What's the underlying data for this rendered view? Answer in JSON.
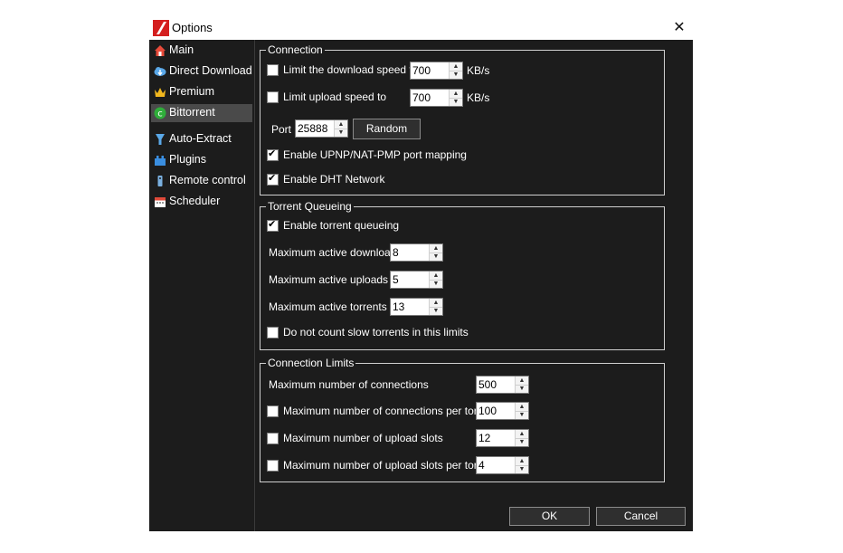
{
  "window": {
    "title": "Options",
    "close_glyph": "✕"
  },
  "sidebar": {
    "items": [
      {
        "label": "Main",
        "icon": "home-icon",
        "selected": false
      },
      {
        "label": "Direct Download",
        "icon": "cloud-download-icon",
        "selected": false
      },
      {
        "label": "Premium",
        "icon": "crown-icon",
        "selected": false
      },
      {
        "label": "Bittorrent",
        "icon": "bittorrent-icon",
        "selected": true
      },
      {
        "label": "Auto-Extract",
        "icon": "extract-icon",
        "selected": false
      },
      {
        "label": "Plugins",
        "icon": "plugin-icon",
        "selected": false
      },
      {
        "label": "Remote control",
        "icon": "remote-icon",
        "selected": false
      },
      {
        "label": "Scheduler",
        "icon": "calendar-icon",
        "selected": false
      }
    ]
  },
  "connection": {
    "title": "Connection",
    "limit_download": {
      "label": "Limit the download speed to",
      "checked": false,
      "value": "700",
      "unit": "KB/s"
    },
    "limit_upload": {
      "label": "Limit upload speed to",
      "checked": false,
      "value": "700",
      "unit": "KB/s"
    },
    "port": {
      "label": "Port",
      "value": "25888",
      "random_label": "Random"
    },
    "upnp": {
      "label": "Enable UPNP/NAT-PMP port mapping",
      "checked": true
    },
    "dht": {
      "label": "Enable DHT Network",
      "checked": true
    }
  },
  "queueing": {
    "title": "Torrent Queueing",
    "enable": {
      "label": "Enable torrent queueing",
      "checked": true
    },
    "max_downloads": {
      "label": "Maximum active downloads",
      "value": "8"
    },
    "max_uploads": {
      "label": "Maximum active uploads",
      "value": "5"
    },
    "max_torrents": {
      "label": "Maximum active torrents",
      "value": "13"
    },
    "slow": {
      "label": "Do not count slow torrents in this limits",
      "checked": false
    }
  },
  "limits": {
    "title": "Connection Limits",
    "max_connections": {
      "label": "Maximum number of connections",
      "value": "500"
    },
    "per_torrent": {
      "label": "Maximum number of connections per torrent",
      "checked": false,
      "value": "100"
    },
    "upload_slots": {
      "label": "Maximum number of upload slots",
      "checked": false,
      "value": "12"
    },
    "slots_per_torrent": {
      "label": "Maximum number of upload slots per torrent",
      "checked": false,
      "value": "4"
    }
  },
  "buttons": {
    "ok": "OK",
    "cancel": "Cancel"
  },
  "colors": {
    "background": "#1c1c1c",
    "selected": "#4a4a4a",
    "accent": "#e02020"
  }
}
